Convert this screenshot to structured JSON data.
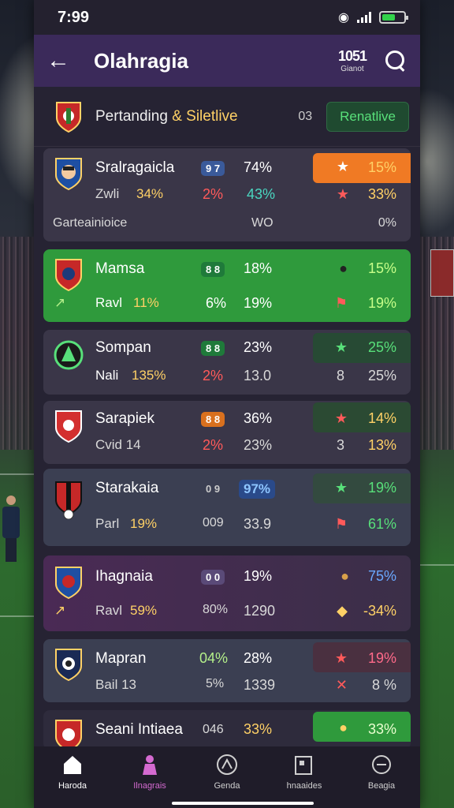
{
  "status": {
    "time": "7:99"
  },
  "header": {
    "title": "Olahragia",
    "stat_value": "1051",
    "stat_label": "Gianot"
  },
  "summary": {
    "title_part1": "Pertanding ",
    "title_amp": "&",
    "title_part2": " Siletlive",
    "count": "03",
    "button": "Renatlive"
  },
  "matches": [
    {
      "name": "Sralragaicla",
      "pill": "9 7",
      "pill_color": "#3a5a9a",
      "pct1": "74%",
      "sub_name": "Zwli",
      "sub_pct": "34%",
      "pct2": "2%",
      "pct3": "43%",
      "right_top": "15%",
      "right_bottom": "33%",
      "extra_label": "Garteainioice",
      "extra_mid": "WO",
      "extra_right": "0%",
      "bg": "#3a3648",
      "right_bg": "#f07a24"
    },
    {
      "name": "Mamsa",
      "pill": "8 8",
      "pill_color": "#1f7a3a",
      "pct1": "18%",
      "sub_name": "Ravl",
      "sub_pct": "11%",
      "pct2": "6%",
      "pct3": "19%",
      "right_top": "15%",
      "right_bottom": "19%",
      "bg": "#2f9a3c"
    },
    {
      "name": "Sompan",
      "pill": "8 8",
      "pill_color": "#1f7a3a",
      "pct1": "23%",
      "sub_name": "Nali",
      "sub_pct": "135%",
      "pct2": "2%",
      "pct3": "13.0",
      "right_top": "25%",
      "right_bottom": "25%",
      "right_mark": "8",
      "bg": "#3a3648",
      "right_bg": "#274a34"
    },
    {
      "name": "Sarapiek",
      "pill": "8 8",
      "pill_color": "#d9701e",
      "pct1": "36%",
      "sub_name": "Cvid 14",
      "pct2": "2%",
      "pct3": "23%",
      "right_top": "14%",
      "right_bottom": "13%",
      "right_mark": "3",
      "bg": "#3a3648",
      "right_bg": "#2b4a33"
    },
    {
      "name": "Starakaia",
      "pill": "97%",
      "pill_color": "#2a4a8a",
      "pill_pre": "0 9",
      "sub_name": "Parl",
      "sub_pct": "19%",
      "pct2": "009",
      "pct3": "33.9",
      "right_top": "19%",
      "right_bottom": "61%",
      "bg": "#3b3f52",
      "right_bg": "#334a3f"
    },
    {
      "name": "Ihagnaia",
      "pill": "0 0",
      "pill_color": "#5a4a78",
      "pct1": "19%",
      "sub_name": "Ravl",
      "sub_pct": "59%",
      "pct2": "80%",
      "pct3": "1290",
      "right_top": "75%",
      "right_bottom": "-34%",
      "bg": "#4a2a55"
    },
    {
      "name": "Mapran",
      "pill": "04%",
      "pct1": "28%",
      "sub_name": "Bail 13",
      "pct2": "5%",
      "pct3": "1339",
      "right_top": "19%",
      "right_bottom": "8 %",
      "bg": "#3b3f52",
      "right_bg": "#4a3040"
    },
    {
      "name": "Seani Intiaea",
      "pre_pct": "046",
      "pct1": "33%",
      "right_top": "33%",
      "bg": "#2e2b3c",
      "right_bg": "#2f9a3c"
    }
  ],
  "nav": [
    {
      "label": "Haroda"
    },
    {
      "label": "Ilnagrais"
    },
    {
      "label": "Genda"
    },
    {
      "label": "hnaaides"
    },
    {
      "label": "Beagia"
    }
  ]
}
